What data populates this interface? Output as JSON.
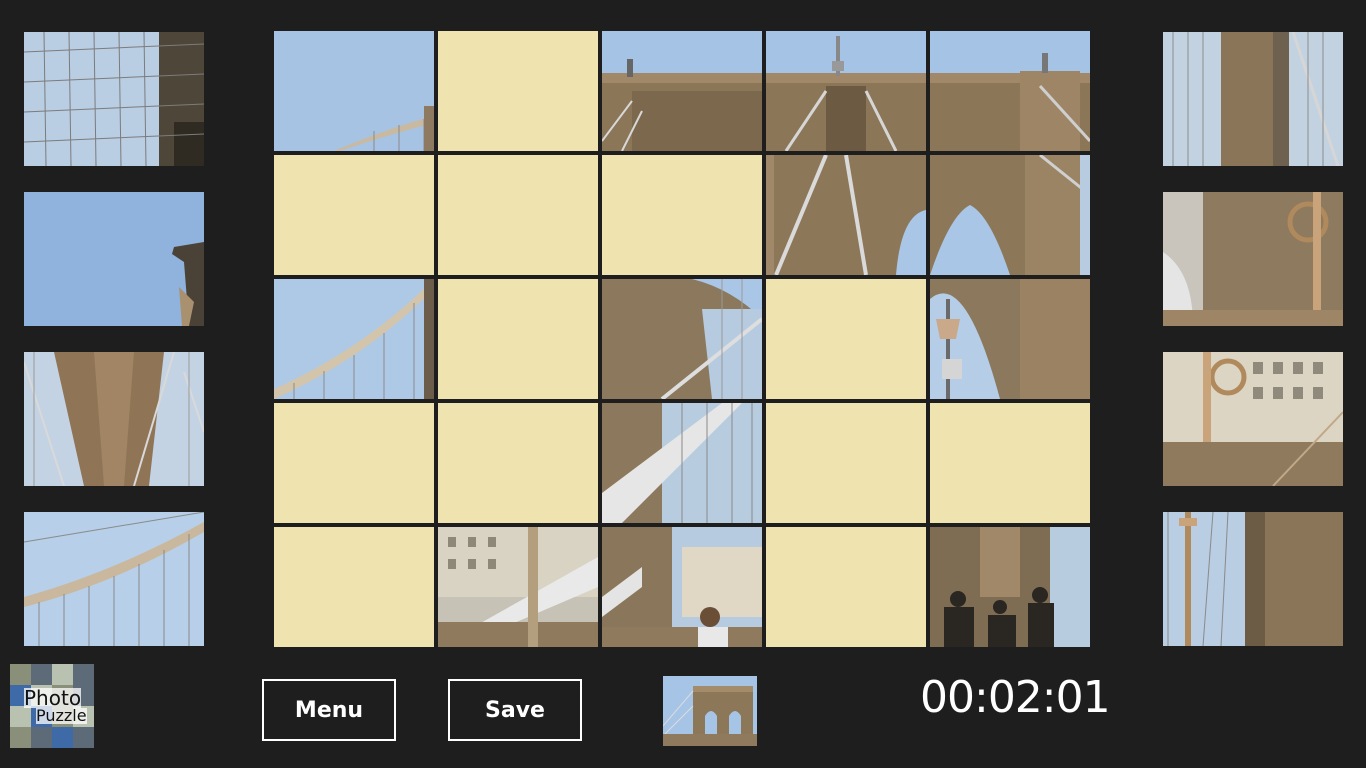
{
  "app": {
    "logo_line1": "Photo",
    "logo_line2": "Puzzle"
  },
  "controls": {
    "menu_label": "Menu",
    "save_label": "Save"
  },
  "timer": {
    "elapsed": "00:02:01"
  },
  "colors": {
    "background": "#1e1e1e",
    "empty_slot": "#efe3b0",
    "sky": "#a9c6e6",
    "stone": "#8f7a5e"
  },
  "board": {
    "rows": 5,
    "cols": 5,
    "cells": [
      [
        "sky-cables",
        "empty",
        "tower-top-left",
        "tower-top-mid",
        "tower-top-right"
      ],
      [
        "empty",
        "empty",
        "empty",
        "tower-arch-left",
        "tower-arch-right"
      ],
      [
        "sky-cable-arc",
        "empty",
        "tower-base-cables",
        "empty",
        "lamp-arch"
      ],
      [
        "empty",
        "empty",
        "walkway-cables",
        "empty",
        "empty"
      ],
      [
        "empty",
        "city-buildings",
        "walkway-pipe",
        "empty",
        "pedestrians"
      ]
    ]
  },
  "left_tray": [
    "cables-stone",
    "sky-tower-edge",
    "stone-cables",
    "sky-cable-arc-2"
  ],
  "right_tray": [
    "stone-cables-right",
    "rail-ironwork",
    "buildings-rail",
    "lamp-post-stone"
  ]
}
